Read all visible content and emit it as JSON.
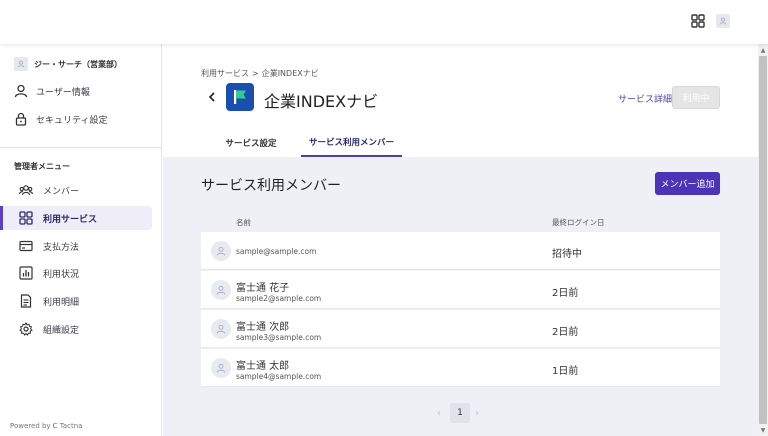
{
  "sidebar": {
    "org_name": "ジー・サーチ（営業部）",
    "user_links": [
      {
        "label": "ユーザー情報",
        "icon": "user-icon"
      },
      {
        "label": "セキュリティ設定",
        "icon": "lock-icon"
      }
    ],
    "admin_title": "管理者メニュー",
    "menu": [
      {
        "label": "メンバー",
        "icon": "members-icon",
        "active": false
      },
      {
        "label": "利用サービス",
        "icon": "grid-icon",
        "active": true
      },
      {
        "label": "支払方法",
        "icon": "credit-card-icon",
        "active": false
      },
      {
        "label": "利用状況",
        "icon": "bar-chart-icon",
        "active": false
      },
      {
        "label": "利用明細",
        "icon": "document-icon",
        "active": false
      },
      {
        "label": "組織設定",
        "icon": "gear-icon",
        "active": false
      }
    ],
    "powered_by": "Powered by",
    "powered_brand": "Tactna"
  },
  "breadcrumb": {
    "parent": "利用サービス",
    "separator": ">",
    "current": "企業INDEXナビ"
  },
  "service": {
    "title": "企業INDEXナビ",
    "detail_link": "サービス詳細",
    "status_button": "利用中"
  },
  "tabs": [
    {
      "label": "サービス設定",
      "active": false
    },
    {
      "label": "サービス利用メンバー",
      "active": true
    }
  ],
  "section": {
    "title": "サービス利用メンバー",
    "add_button": "メンバー追加"
  },
  "table": {
    "headers": {
      "name": "名前",
      "last_login": "最終ログイン日"
    },
    "rows": [
      {
        "name": "",
        "email": "sample@sample.com",
        "last_login": "招待中"
      },
      {
        "name": "富士通 花子",
        "email": "sample2@sample.com",
        "last_login": "2日前"
      },
      {
        "name": "富士通 次郎",
        "email": "sample3@sample.com",
        "last_login": "2日前"
      },
      {
        "name": "富士通 太郎",
        "email": "sample4@sample.com",
        "last_login": "1日前"
      }
    ]
  },
  "pagination": {
    "prev": "‹",
    "current": "1",
    "next": "›"
  },
  "colors": {
    "accent": "#4b35b6",
    "logo": "#1a4fb0",
    "background": "#eef0f5"
  }
}
